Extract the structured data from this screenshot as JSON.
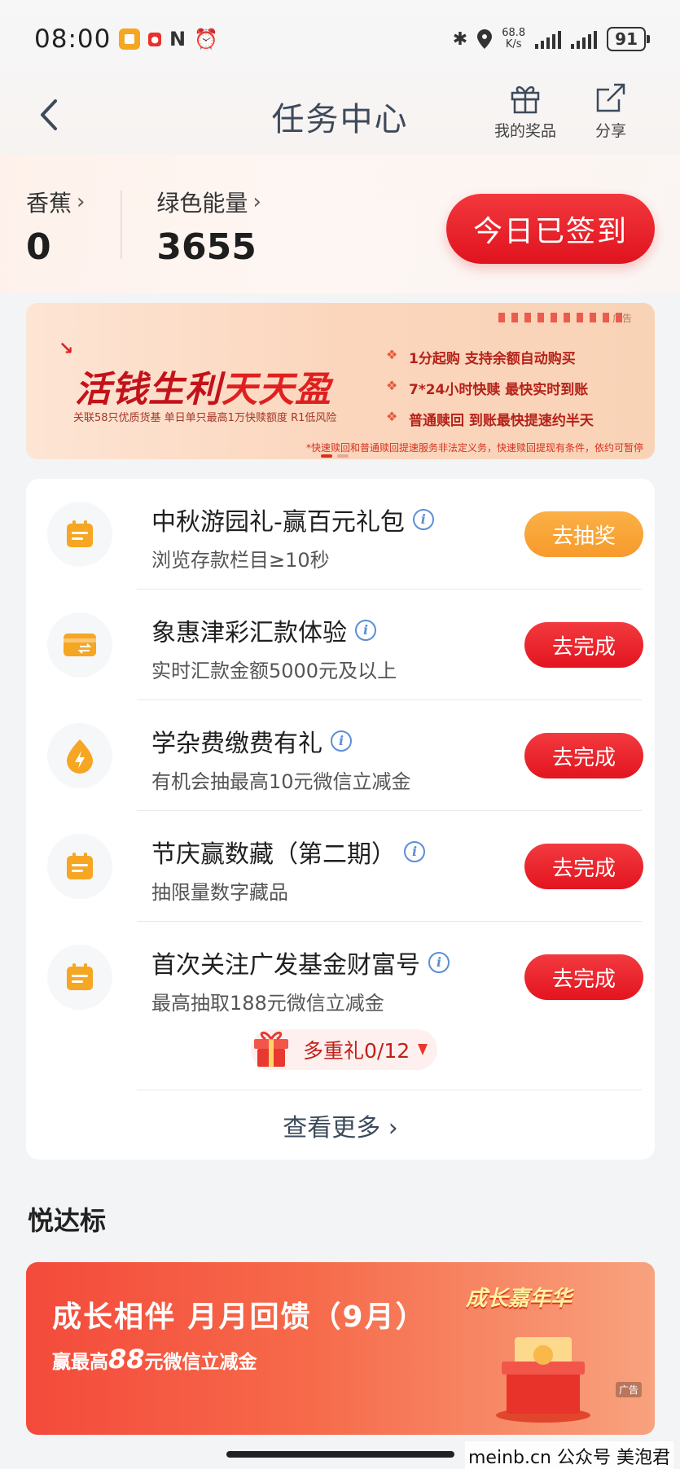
{
  "status_bar": {
    "time": "08:00",
    "net_speed_value": "68.8",
    "net_speed_unit": "K/s",
    "battery": "91"
  },
  "header": {
    "title": "任务中心",
    "prizes_label": "我的奖品",
    "share_label": "分享"
  },
  "points": {
    "banana_label": "香蕉",
    "banana_value": "0",
    "energy_label": "绿色能量",
    "energy_value": "3655",
    "signin_label": "今日已签到"
  },
  "ad_banner": {
    "tag": "广告",
    "title_part1": "活钱生利",
    "title_part2": "天天盈",
    "subtitle": "关联58只优质货基  单日单只最高1万快赎额度  R1低风险",
    "features": [
      "1分起购 支持余额自动购买",
      "7*24小时快赎 最快实时到账",
      "普通赎回 到账最快提速约半天"
    ],
    "note": "*快速赎回和普通赎回提速服务非法定义务，快速赎回提现有条件，依约可暂停"
  },
  "tasks": [
    {
      "title": "中秋游园礼-赢百元礼包",
      "desc": "浏览存款栏目≥10秒",
      "button": "去抽奖",
      "icon": "calendar-icon",
      "button_color": "#f79a2b"
    },
    {
      "title": "象惠津彩汇款体验",
      "desc": "实时汇款金额5000元及以上",
      "button": "去完成",
      "icon": "transfer-card-icon",
      "button_color": "#e3141f"
    },
    {
      "title": "学杂费缴费有礼",
      "desc": "有机会抽最高10元微信立减金",
      "button": "去完成",
      "icon": "lightning-icon",
      "button_color": "#e3141f"
    },
    {
      "title": "节庆赢数藏（第二期）",
      "desc": "抽限量数字藏品",
      "button": "去完成",
      "icon": "calendar-icon",
      "button_color": "#e3141f"
    },
    {
      "title": "首次关注广发基金财富号",
      "desc": "最高抽取188元微信立减金",
      "button": "去完成",
      "icon": "calendar-icon",
      "button_color": "#e3141f"
    }
  ],
  "multi_gift": "多重礼0/12",
  "see_more": "查看更多",
  "section": {
    "title": "悦达标"
  },
  "growth_banner": {
    "title": "成长相伴  月月回馈（9月）",
    "sub_prefix": "赢最高",
    "sub_amount": "88",
    "sub_suffix": "元微信立减金",
    "carnival": "成长嘉年华",
    "badge": "广告"
  },
  "watermark": "meinb.cn  公众号 美泡君",
  "colors": {
    "primary_red": "#e3141f",
    "orange": "#f79a2b",
    "icon_orange": "#f5a623",
    "link_blue": "#5b8fd6"
  }
}
